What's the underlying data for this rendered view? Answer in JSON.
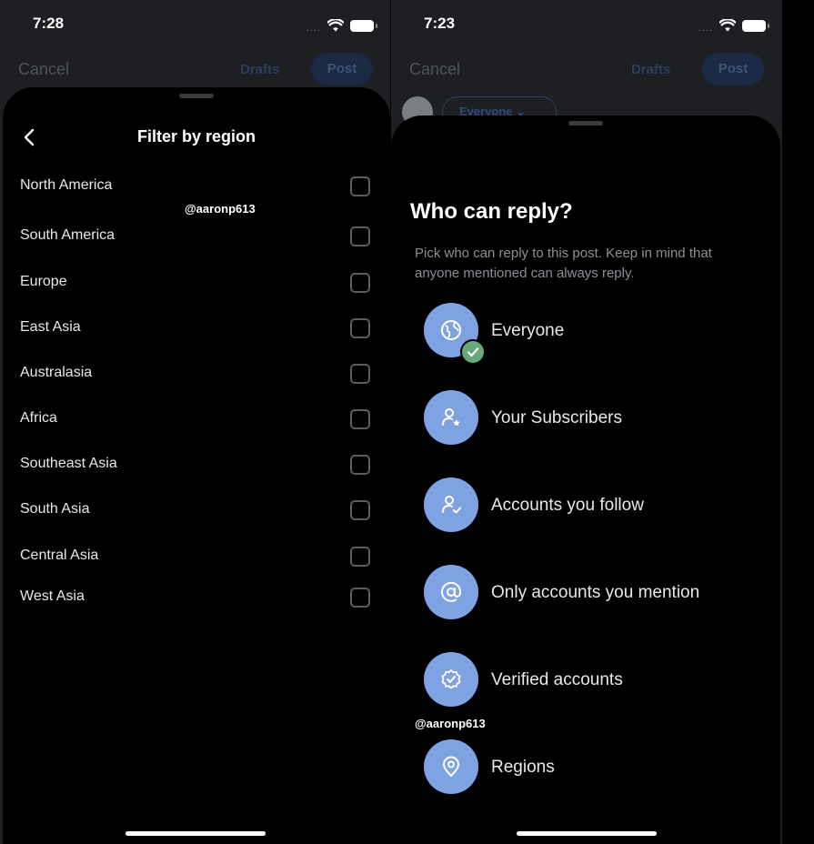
{
  "left_screen": {
    "status": {
      "time": "7:28",
      "signal": "...."
    },
    "top_bar": {
      "cancel": "Cancel",
      "drafts": "Drafts",
      "post": "Post"
    },
    "sheet": {
      "title": "Filter by region",
      "watermark": "@aaronp613",
      "regions": [
        {
          "label": "North America",
          "checked": false
        },
        {
          "label": "South America",
          "checked": false
        },
        {
          "label": "Europe",
          "checked": false
        },
        {
          "label": "East Asia",
          "checked": false
        },
        {
          "label": "Australasia",
          "checked": false
        },
        {
          "label": "Africa",
          "checked": false
        },
        {
          "label": "Southeast Asia",
          "checked": false
        },
        {
          "label": "South Asia",
          "checked": false
        },
        {
          "label": "Central Asia",
          "checked": false
        },
        {
          "label": "West Asia",
          "checked": false
        }
      ]
    }
  },
  "right_screen": {
    "status": {
      "time": "7:23",
      "signal": "...."
    },
    "top_bar": {
      "cancel": "Cancel",
      "drafts": "Drafts",
      "post": "Post",
      "audience": "Everyone"
    },
    "sheet": {
      "title": "Who can reply?",
      "description": "Pick who can reply to this post. Keep in mind that anyone mentioned can always reply.",
      "watermark": "@aaronp613",
      "options": [
        {
          "label": "Everyone",
          "icon": "globe-icon",
          "selected": true
        },
        {
          "label": "Your Subscribers",
          "icon": "person-star-icon",
          "selected": false
        },
        {
          "label": "Accounts you follow",
          "icon": "person-check-icon",
          "selected": false
        },
        {
          "label": "Only accounts you mention",
          "icon": "at-sign-icon",
          "selected": false
        },
        {
          "label": "Verified accounts",
          "icon": "verified-badge-icon",
          "selected": false
        },
        {
          "label": "Regions",
          "icon": "location-pin-icon",
          "selected": false
        }
      ]
    }
  },
  "colors": {
    "option_circle": "#7fa2e2",
    "selected_check": "#6aa77b",
    "sheet_background": "#000000",
    "backdrop": "#1e1f22"
  }
}
